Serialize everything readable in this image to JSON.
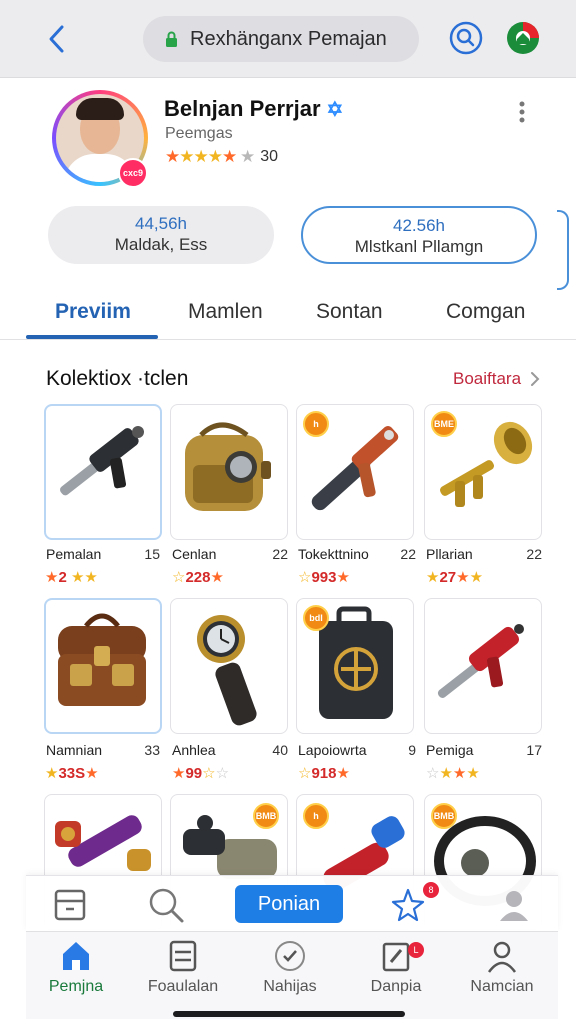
{
  "browser": {
    "url_text": "Rexhänganx Pemajan"
  },
  "profile": {
    "name": "Belnjan Perrjar",
    "subtitle": "Peemgas",
    "rating_count": "30",
    "avatar_badge": "cxc9"
  },
  "stats": [
    {
      "value": "44,56h",
      "label": "Maldak, Ess"
    },
    {
      "value": "42.56h",
      "label": "Mlstkanl Pllamgn"
    }
  ],
  "tabs": [
    "Previim",
    "Mamlen",
    "Sontan",
    "Comgan"
  ],
  "section": {
    "title": "Kolektiox ·tclen",
    "link": "Boaiftara"
  },
  "items": [
    {
      "name": "Pemalan",
      "count": "15",
      "rating": "2"
    },
    {
      "name": "Cenlan",
      "count": "22",
      "rating": "228"
    },
    {
      "name": "Tokekttnino",
      "count": "22",
      "rating": "993"
    },
    {
      "name": "Pllarian",
      "count": "22",
      "rating": "27"
    },
    {
      "name": "Namnian",
      "count": "33",
      "rating": "33S"
    },
    {
      "name": "Anhlea",
      "count": "40",
      "rating": "99"
    },
    {
      "name": "Lapoiowrta",
      "count": "9",
      "rating": "918"
    },
    {
      "name": "Pemiga",
      "count": "17",
      "rating": ""
    }
  ],
  "card_badges": [
    "h",
    "BME",
    "bdI",
    "h",
    "BMB"
  ],
  "actionbar": {
    "primary_label": "Ponian",
    "notif_count": "8"
  },
  "bottom_nav": [
    {
      "label": "Pemjna",
      "icon": "home-icon",
      "active": true
    },
    {
      "label": "Foaulalan",
      "icon": "list-icon"
    },
    {
      "label": "Nahijas",
      "icon": "check-circle-icon"
    },
    {
      "label": "Danpia",
      "icon": "edit-note-icon",
      "badge": "L"
    },
    {
      "label": "Namcian",
      "icon": "person-icon"
    }
  ],
  "colors": {
    "accent": "#2463b4",
    "primary_button": "#1f7ee6",
    "link_red": "#c0283d",
    "active_nav": "#1a7a3c"
  }
}
